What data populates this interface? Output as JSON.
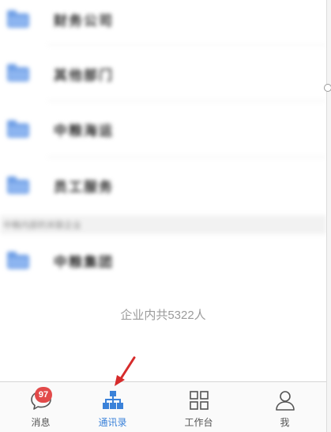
{
  "departments": [
    {
      "label": "财务公司"
    },
    {
      "label": "其他部门"
    },
    {
      "label": "中粮海运"
    },
    {
      "label": "员工服务"
    }
  ],
  "section_header": "中粮内部的关联企业",
  "group_departments": [
    {
      "label": "中粮集团"
    }
  ],
  "footer": {
    "count_text": "企业内共5322人"
  },
  "tabbar": {
    "tabs": [
      {
        "label": "消息",
        "icon": "chat-bubble-icon",
        "badge": "97",
        "active": false
      },
      {
        "label": "通讯录",
        "icon": "org-chart-icon",
        "active": true
      },
      {
        "label": "工作台",
        "icon": "grid-icon",
        "active": false
      },
      {
        "label": "我",
        "icon": "person-icon",
        "active": false
      }
    ]
  },
  "colors": {
    "accent": "#3b82d9",
    "badge": "#e24a4a",
    "folder": "#6f9fe6",
    "arrow": "#d62b2b"
  }
}
